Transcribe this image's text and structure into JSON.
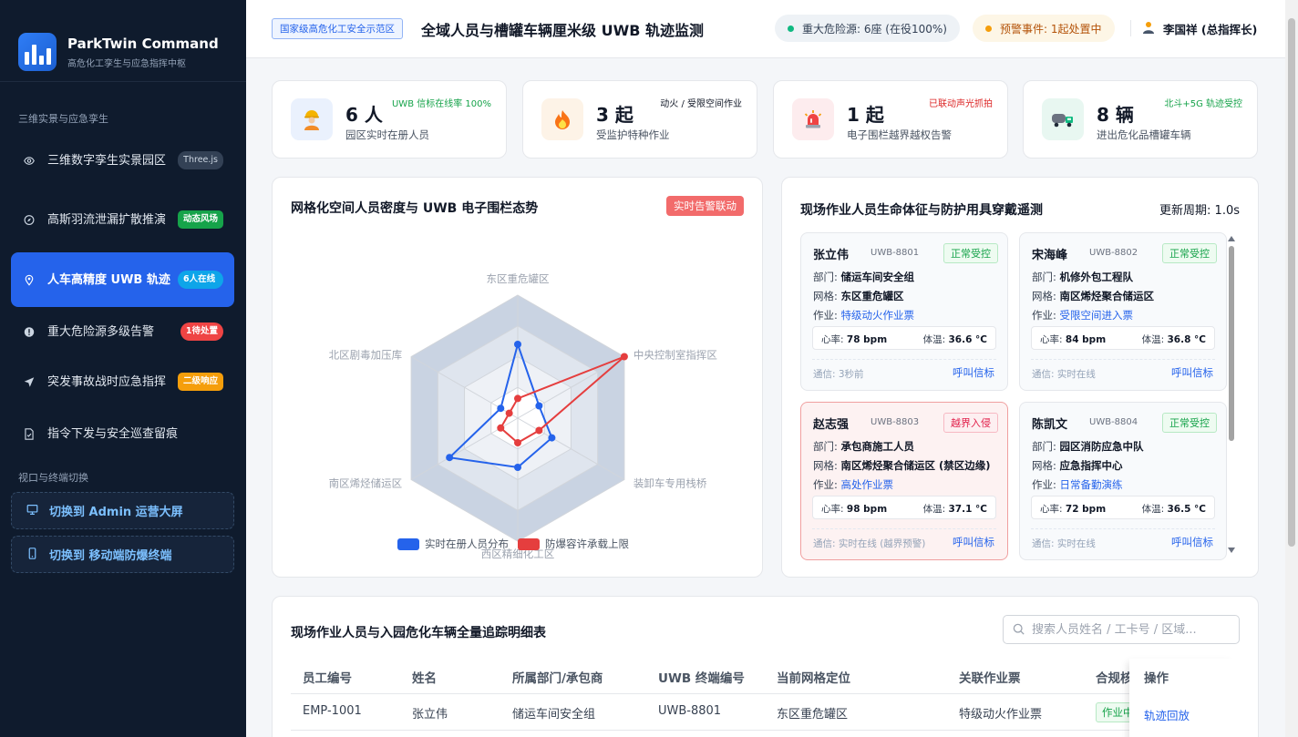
{
  "brand": {
    "title": "ParkTwin Command",
    "subtitle": "高危化工孪生与应急指挥中枢"
  },
  "sidebar": {
    "group1": "三维实景与应急孪生",
    "items": [
      {
        "label": "三维数字孪生实景园区",
        "badge": "Three.js",
        "icon": "eye-icon"
      },
      {
        "label": "高斯羽流泄漏扩散推演",
        "badge": "动态风场",
        "icon": "compass-icon"
      },
      {
        "label": "人车高精度 UWB 轨迹",
        "badge": "6人在线",
        "icon": "location-pin-icon"
      },
      {
        "label": "重大危险源多级告警",
        "badge": "1待处置",
        "icon": "alert-icon"
      },
      {
        "label": "突发事故战时应急指挥",
        "badge": "二级响应",
        "icon": "send-icon"
      },
      {
        "label": "指令下发与安全巡查留痕",
        "badge": "",
        "icon": "document-icon"
      }
    ],
    "group2": "视口与终端切换",
    "switches": [
      {
        "label": "切换到 Admin 运营大屏",
        "icon": "monitor-icon"
      },
      {
        "label": "切换到 移动端防爆终端",
        "icon": "mobile-icon"
      }
    ]
  },
  "header": {
    "tag": "国家级高危化工安全示范区",
    "title": "全域人员与槽罐车辆厘米级 UWB 轨迹监测",
    "hazard": "重大危险源: 6座 (在役100%)",
    "warning": "预警事件: 1起处置中",
    "user": "李国祥 (总指挥长)"
  },
  "stats": [
    {
      "value": "6 人",
      "label": "园区实时在册人员",
      "note": "UWB 信标在线率 100%",
      "icon": "worker-icon"
    },
    {
      "value": "3 起",
      "label": "受监护特种作业",
      "note": "动火 / 受限空间作业",
      "icon": "fire-icon"
    },
    {
      "value": "1 起",
      "label": "电子围栏越界越权告警",
      "note": "已联动声光抓拍",
      "icon": "siren-icon"
    },
    {
      "value": "8 辆",
      "label": "进出危化品槽罐车辆",
      "note": "北斗+5G 轨迹受控",
      "icon": "truck-icon"
    }
  ],
  "radar_panel": {
    "title": "网格化空间人员密度与 UWB 电子围栏态势",
    "tag": "实时告警联动"
  },
  "chart_data": {
    "type": "radar",
    "axes": [
      "东区重危罐区",
      "中央控制室指挥区",
      "装卸车专用栈桥",
      "西区精细化工区",
      "南区烯烃储运区",
      "北区剧毒加压库"
    ],
    "max": 5,
    "series": [
      {
        "name": "实时在册人员分布",
        "color": "#2563eb",
        "values": [
          3,
          1,
          1.6,
          2,
          3.2,
          0.8
        ]
      },
      {
        "name": "防爆容许承载上限",
        "color": "#e53e3e",
        "values": [
          0.8,
          5,
          1,
          1,
          0.8,
          0.4
        ]
      }
    ]
  },
  "vitals": {
    "title": "现场作业人员生命体征与防护用具穿戴遥测",
    "period": "更新周期: 1.0s",
    "cards": [
      {
        "name": "张立伟",
        "id": "UWB-8801",
        "status": "正常受控",
        "alert": false,
        "dept": "储运车间安全组",
        "grid": "东区重危罐区",
        "job": "特级动火作业票",
        "hr": "78 bpm",
        "temp": "36.6 °C",
        "comm": "通信: 3秒前",
        "call": "呼叫信标"
      },
      {
        "name": "宋海峰",
        "id": "UWB-8802",
        "status": "正常受控",
        "alert": false,
        "dept": "机修外包工程队",
        "grid": "南区烯烃聚合储运区",
        "job": "受限空间进入票",
        "hr": "84 bpm",
        "temp": "36.8 °C",
        "comm": "通信: 实时在线",
        "call": "呼叫信标"
      },
      {
        "name": "赵志强",
        "id": "UWB-8803",
        "status": "越界入侵",
        "alert": true,
        "dept": "承包商施工人员",
        "grid": "南区烯烃聚合储运区 (禁区边缘)",
        "job": "高处作业票",
        "hr": "98 bpm",
        "temp": "37.1 °C",
        "comm": "通信: 实时在线 (越界预警)",
        "call": "呼叫信标"
      },
      {
        "name": "陈凯文",
        "id": "UWB-8804",
        "status": "正常受控",
        "alert": false,
        "dept": "园区消防应急中队",
        "grid": "应急指挥中心",
        "job": "日常备勤演练",
        "hr": "72 bpm",
        "temp": "36.5 °C",
        "comm": "通信: 实时在线",
        "call": "呼叫信标"
      }
    ],
    "labels": {
      "dept": "部门: ",
      "grid": "网格: ",
      "job": "作业: ",
      "hr": "心率: ",
      "temp": "体温: "
    }
  },
  "table": {
    "title": "现场作业人员与入园危化车辆全量追踪明细表",
    "search_placeholder": "搜索人员姓名 / 工卡号 / 区域...",
    "headers": [
      "员工编号",
      "姓名",
      "所属部门/承包商",
      "UWB 终端编号",
      "当前网格定位",
      "关联作业票",
      "合规核",
      "操作"
    ],
    "rows": [
      {
        "cells": [
          "EMP-1001",
          "张立伟",
          "储运车间安全组",
          "UWB-8801",
          "东区重危罐区",
          "特级动火作业票",
          "作业中"
        ],
        "action": "轨迹回放"
      }
    ]
  }
}
